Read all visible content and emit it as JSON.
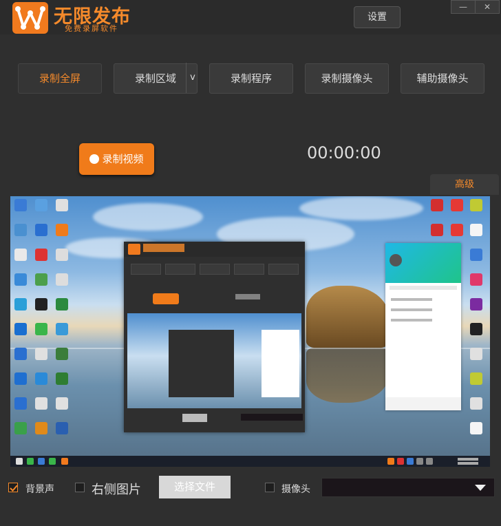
{
  "app": {
    "brand": "无限发布",
    "slogan": "免费录屏软件",
    "settings_label": "设置",
    "minimize_label": "—",
    "close_label": "✕"
  },
  "modes": [
    {
      "label": "录制全屏",
      "active": true
    },
    {
      "label": "录制区域",
      "active": false
    },
    {
      "label": "录制程序",
      "active": false
    },
    {
      "label": "录制摄像头",
      "active": false
    },
    {
      "label": "辅助摄像头",
      "active": false
    }
  ],
  "region_dropdown_glyph": "v",
  "record_button_label": "录制视频",
  "timer": "00:00:00",
  "advanced_label": "高级",
  "bottom": {
    "bg_sound_label": "背景声",
    "bg_sound_checked": true,
    "right_image_label": "右侧图片",
    "right_image_checked": false,
    "choose_file_label": "选择文件",
    "camera_label": "摄像头",
    "camera_checked": false,
    "camera_select_value": ""
  },
  "colors": {
    "accent": "#f58a2b",
    "record": "#f07b1a",
    "background": "#2f2f2f"
  }
}
